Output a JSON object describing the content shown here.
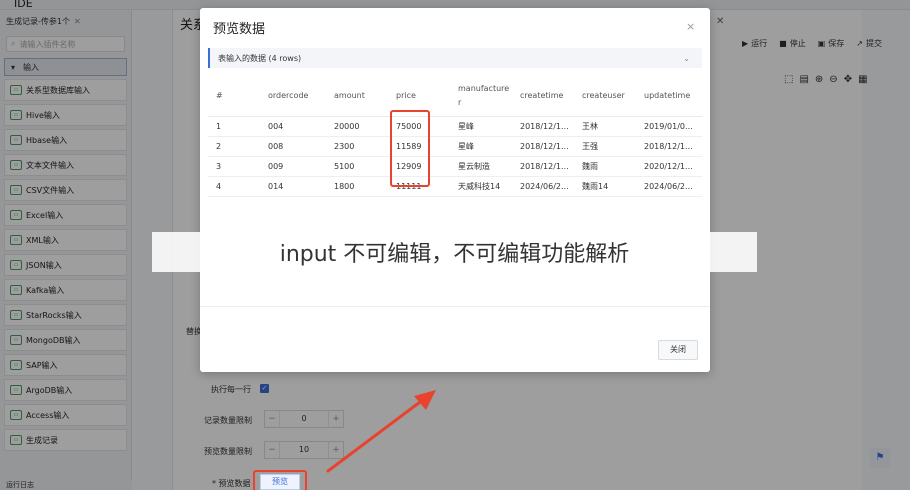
{
  "app": {
    "title": "IDE"
  },
  "sidebar": {
    "tab_label": "生成记录-传参1个",
    "tab_close": "✕",
    "search_placeholder": "请输入插件名称",
    "group_label": "输入",
    "items": [
      {
        "label": "关系型数据库输入",
        "icon": "database-icon"
      },
      {
        "label": "Hive输入",
        "icon": "hive-icon"
      },
      {
        "label": "Hbase输入",
        "icon": "hbase-icon"
      },
      {
        "label": "文本文件输入",
        "icon": "text-file-icon"
      },
      {
        "label": "CSV文件输入",
        "icon": "csv-icon"
      },
      {
        "label": "Excel输入",
        "icon": "excel-icon"
      },
      {
        "label": "XML输入",
        "icon": "xml-icon"
      },
      {
        "label": "JSON输入",
        "icon": "json-icon"
      },
      {
        "label": "Kafka输入",
        "icon": "kafka-icon"
      },
      {
        "label": "StarRocks输入",
        "icon": "starrocks-icon"
      },
      {
        "label": "MongoDB输入",
        "icon": "mongodb-icon"
      },
      {
        "label": "SAP输入",
        "icon": "sap-icon"
      },
      {
        "label": "ArgoDB输入",
        "icon": "argodb-icon"
      },
      {
        "label": "Access输入",
        "icon": "access-icon"
      },
      {
        "label": "生成记录",
        "icon": "record-icon"
      }
    ],
    "status": "运行日志"
  },
  "panel": {
    "title": "关系",
    "toolbar": {
      "run": "运行",
      "stop": "停止",
      "save": "保存",
      "submit": "提交"
    },
    "side_label": "替换",
    "form": {
      "exec_each_row": "执行每一行",
      "record_limit_label": "记录数量限制",
      "record_limit_value": "0",
      "preview_limit_label": "预览数量限制",
      "preview_limit_value": "10",
      "preview_data_label": "* 预览数据",
      "preview_button": "预览"
    }
  },
  "dialog": {
    "title": "预览数据",
    "close": "×",
    "section": "表输入的数据 (4 rows)",
    "columns": [
      "#",
      "ordercode",
      "amount",
      "price",
      "manufacture r",
      "createtime",
      "createuser",
      "updatetime"
    ],
    "rows": [
      [
        "1",
        "004",
        "20000",
        "75000",
        "星峰",
        "2018/12/1...",
        "王林",
        "2019/01/0..."
      ],
      [
        "2",
        "008",
        "2300",
        "11589",
        "星峰",
        "2018/12/1...",
        "王强",
        "2018/12/1..."
      ],
      [
        "3",
        "009",
        "5100",
        "12909",
        "星云制造",
        "2018/12/1...",
        "魏雨",
        "2020/12/1..."
      ],
      [
        "4",
        "014",
        "1800",
        "11111",
        "天威科技14",
        "2024/06/2...",
        "魏雨14",
        "2024/06/2..."
      ]
    ],
    "close_button": "关闭"
  },
  "caption": "input 不可编辑，不可编辑功能解析",
  "colors": {
    "accent": "#3a6fd8",
    "highlight": "#e8432e"
  }
}
